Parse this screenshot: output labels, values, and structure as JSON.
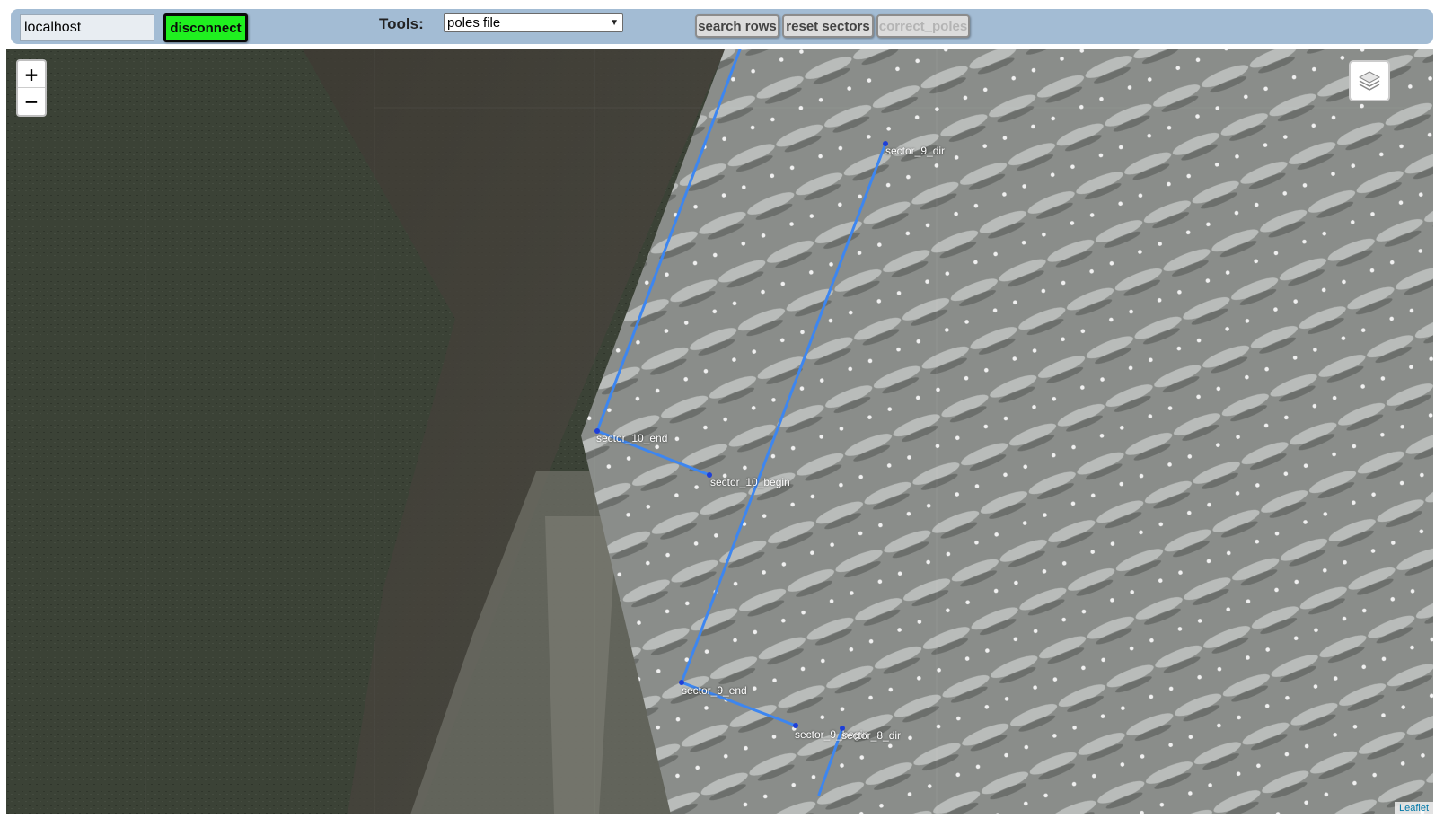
{
  "toolbar": {
    "host_value": "localhost",
    "disconnect_label": "disconnect",
    "disconnect_color": "#1ff01f",
    "tools_label": "Tools:",
    "tools_selected": "poles file",
    "search_rows_label": "search rows",
    "reset_sectors_label": "reset sectors",
    "correct_poles_label": "correct_poles",
    "background_color": "#a3bcd4"
  },
  "map": {
    "zoom_in": "+",
    "zoom_out": "−",
    "layers_icon": "layers-icon",
    "attribution": "Leaflet",
    "route_color": "#3d86f0",
    "labels": {
      "sector_9_dir": "sector_9_dir",
      "sector_10_end": "sector_10_end",
      "sector_10_begin": "sector_10_begin",
      "sector_9_end": "sector_9_end",
      "sector_9_begin": "sector_9_begin",
      "sector_8_dir": "sector_8_dir"
    }
  }
}
